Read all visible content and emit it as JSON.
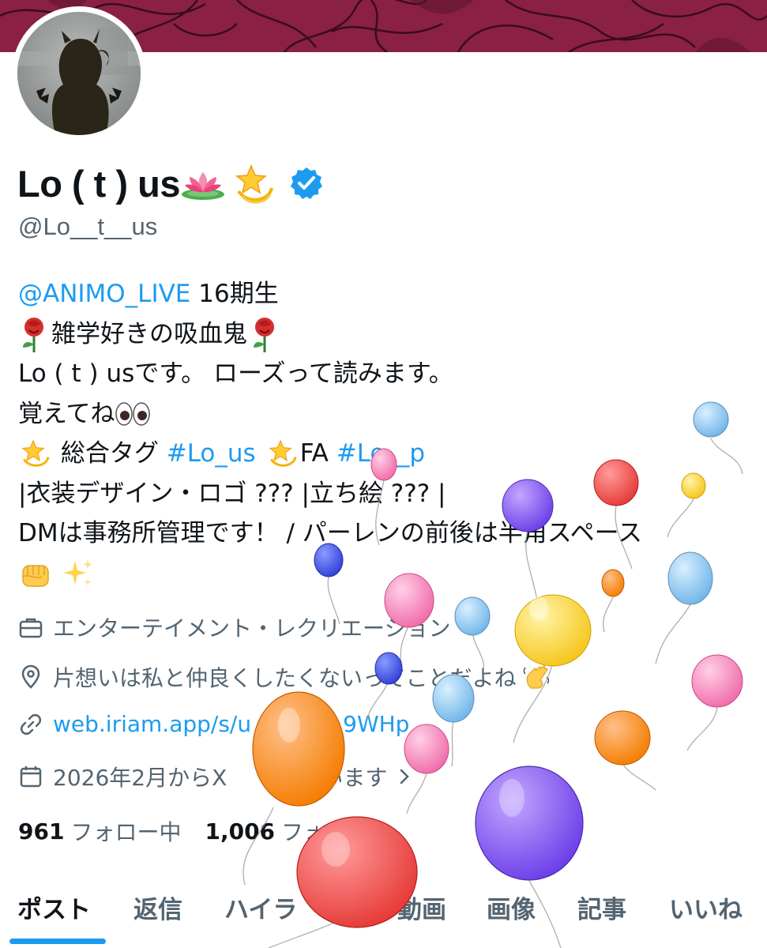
{
  "profile": {
    "display_name": "Lo ( t ) us",
    "handle": "@Lo__t__us",
    "verified": true
  },
  "bio": {
    "mention": "@ANIMO_LIVE",
    "line1_rest": " 16期生",
    "line2": "雑学好きの吸血鬼",
    "line3": "Lo ( t ) usです。 ローズって読みます。",
    "line4": "覚えてね",
    "line5_prefix": " 総合タグ ",
    "line5_tag1": "#Lo_us",
    "line5_mid": "FA ",
    "line5_tag2": "#Lo__p",
    "line6": "|衣装デザイン・ロゴ ??? |立ち絵 ??? |",
    "line7": "DMは事務所管理です！ / パーレンの前後は半角スペース"
  },
  "meta": {
    "category": "エンターテイメント・レクリエーション",
    "location": "片想いは私と仲良くしたくないってことだよね",
    "website": "web.iriam.app/s/u",
    "website_end": "9WHp",
    "joined_prefix": "2026年2月からX",
    "joined_suffix": "しています"
  },
  "follow": {
    "following_count": "961",
    "following_label": "フォロー中",
    "followers_count": "1,006",
    "followers_label": "フォ"
  },
  "tabs": [
    {
      "label": "ポスト",
      "active": true
    },
    {
      "label": "返信",
      "active": false
    },
    {
      "label": "ハイラ",
      "active": false
    },
    {
      "label": "動画",
      "active": false
    },
    {
      "label": "画像",
      "active": false
    },
    {
      "label": "記事",
      "active": false
    },
    {
      "label": "いいね",
      "active": false
    }
  ],
  "colors": {
    "banner": "#8a2044",
    "link": "#1d9bf0",
    "secondary_text": "#536471",
    "primary_text": "#0f1419",
    "verified_badge": "#1d9bf0"
  },
  "icons": {
    "category": "briefcase-icon",
    "location": "location-pin-icon",
    "website": "link-icon",
    "joined": "calendar-icon",
    "verified": "verified-badge-icon"
  }
}
